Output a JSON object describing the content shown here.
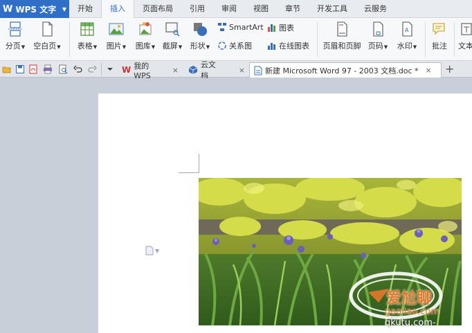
{
  "app": {
    "logo": "W",
    "name": "WPS 文字"
  },
  "menu_tabs": [
    {
      "label": "开始"
    },
    {
      "label": "插入"
    },
    {
      "label": "页面布局"
    },
    {
      "label": "引用"
    },
    {
      "label": "审阅"
    },
    {
      "label": "视图"
    },
    {
      "label": "章节"
    },
    {
      "label": "开发工具"
    },
    {
      "label": "云服务"
    }
  ],
  "active_tab_index": 1,
  "ribbon": {
    "page_break": "分页",
    "blank_page": "空白页",
    "table": "表格",
    "picture": "图片",
    "gallery": "图库",
    "screenshot": "截屏",
    "shape": "形状",
    "smartart": "SmartArt",
    "chart": "图表",
    "relation": "关系图",
    "online_chart": "在线图表",
    "header_footer": "页眉和页脚",
    "page_number": "页码",
    "watermark": "水印",
    "comment": "批注",
    "textbox": "文本"
  },
  "doc_tabs": [
    {
      "label": "我的WPS",
      "close": "×"
    },
    {
      "label": "云文档",
      "close": "×"
    },
    {
      "label": "新建 Microsoft Word 97 - 2003 文档.doc *",
      "close": "×"
    }
  ],
  "new_tab": "+",
  "watermark_text": {
    "line1": "爱尬聊",
    "line2": "gaoliao.com",
    "line3": "qkutu.com-"
  },
  "colors": {
    "accent": "#2f6fc7",
    "wps_red": "#d0312d",
    "canvas": "#c9cfd8",
    "watermark_orange": "#e8782a"
  }
}
